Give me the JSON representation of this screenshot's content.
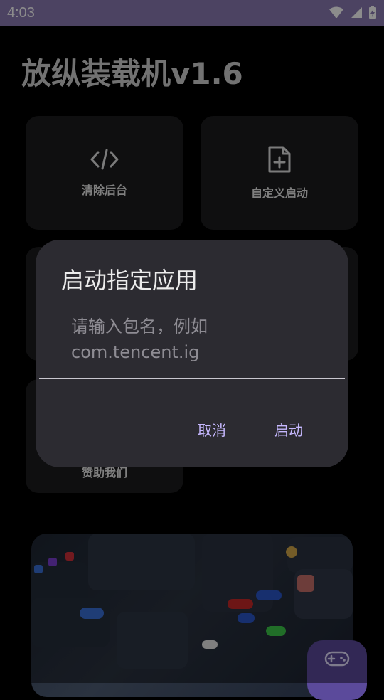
{
  "status_bar": {
    "time": "4:03",
    "background": "#8b7bb3"
  },
  "app": {
    "title": "放纵装载机v1.6"
  },
  "cards": {
    "clear": {
      "label": "清除后台",
      "icon": "code-icon"
    },
    "custom": {
      "label": "自定义启动",
      "icon": "file-add-icon"
    },
    "sponsor": {
      "label": "赞助我们"
    }
  },
  "dialog": {
    "title": "启动指定应用",
    "input_placeholder": "请输入包名，例如com.tencent.ig",
    "input_value": "",
    "cancel_label": "取消",
    "confirm_label": "启动"
  },
  "fab": {
    "icon": "gamepad-icon",
    "color": "#5b4a9b"
  },
  "colors": {
    "accent": "#c6b8ff",
    "card": "#1c1c1e",
    "dialog": "#2c2b31"
  }
}
